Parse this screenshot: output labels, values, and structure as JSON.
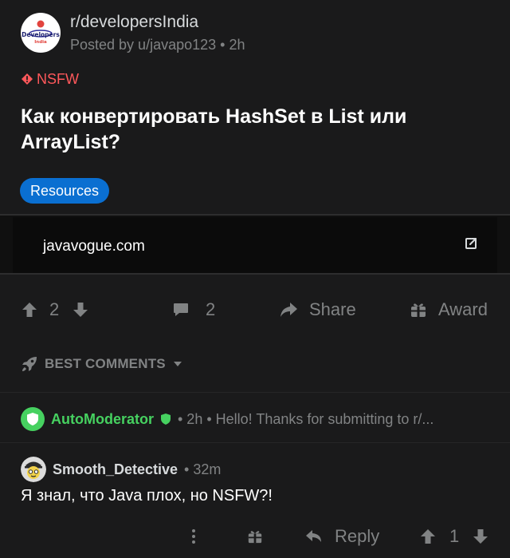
{
  "post": {
    "subreddit": "r/developersIndia",
    "meta": "Posted by u/javapo123 • 2h",
    "avatar_text_1": "Developers",
    "avatar_text_2": "India",
    "nsfw_label": "NSFW",
    "title": "Как конвертировать HashSet в List или ArrayList?",
    "flair": "Resources",
    "link_domain": "javavogue.com"
  },
  "actions": {
    "vote_count": "2",
    "comment_count": "2",
    "share_label": "Share",
    "award_label": "Award"
  },
  "comments_section": {
    "sort_label": "BEST COMMENTS"
  },
  "mod_comment": {
    "author": "AutoModerator",
    "meta": "• 2h • Hello! Thanks for submitting to r/..."
  },
  "comment": {
    "author": "Smooth_Detective",
    "time": "• 32m",
    "body": "Я знал, что Java плох, но NSFW?!",
    "reply_label": "Reply",
    "vote_count": "1"
  },
  "colors": {
    "background": "#1a1a1b",
    "nsfw": "#ff585b",
    "flair": "#0a6fd1",
    "moderator": "#46d160",
    "muted": "#818384"
  }
}
